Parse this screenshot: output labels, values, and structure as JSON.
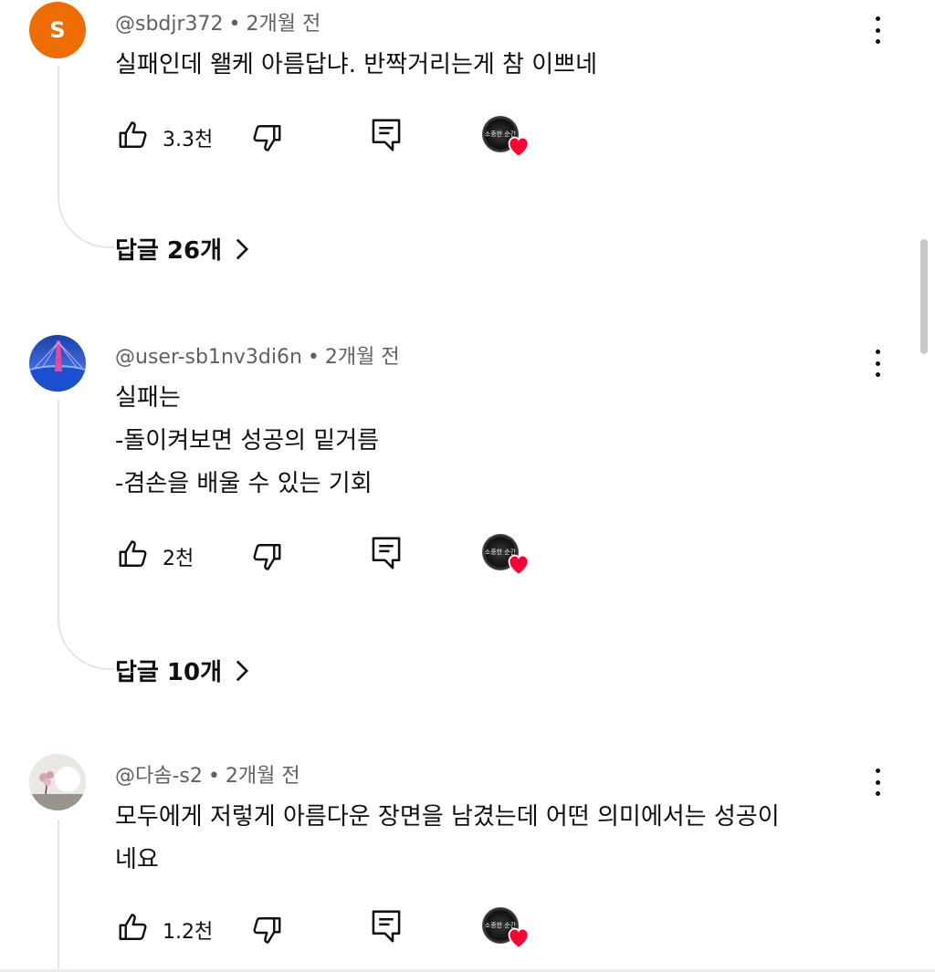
{
  "comments": [
    {
      "avatar_letter": "S",
      "handle": "@sbdjr372",
      "separator": "•",
      "time": "2개월 전",
      "lines": [
        "실패인데 왤케 아름답냐. 반짝거리는게 참 이쁘네"
      ],
      "likes": "3.3천",
      "replies_label": "답글 26개"
    },
    {
      "handle": "@user-sb1nv3di6n",
      "separator": "•",
      "time": "2개월 전",
      "lines": [
        "실패는",
        "-돌이켜보면 성공의 밑거름",
        "-겸손을 배울 수 있는 기회"
      ],
      "likes": "2천",
      "replies_label": "답글 10개"
    },
    {
      "handle": "@다솜-s2",
      "separator": "•",
      "time": "2개월 전",
      "lines": [
        "모두에게 저렇게 아름다운 장면을 남겼는데 어떤 의미에서는 성공이",
        "네요"
      ],
      "likes": "1.2천"
    }
  ],
  "creator_badge_text": "소중한 순간",
  "colors": {
    "accent_orange": "#ef6c00",
    "heart": "#ff0033",
    "meta_gray": "#606060"
  }
}
